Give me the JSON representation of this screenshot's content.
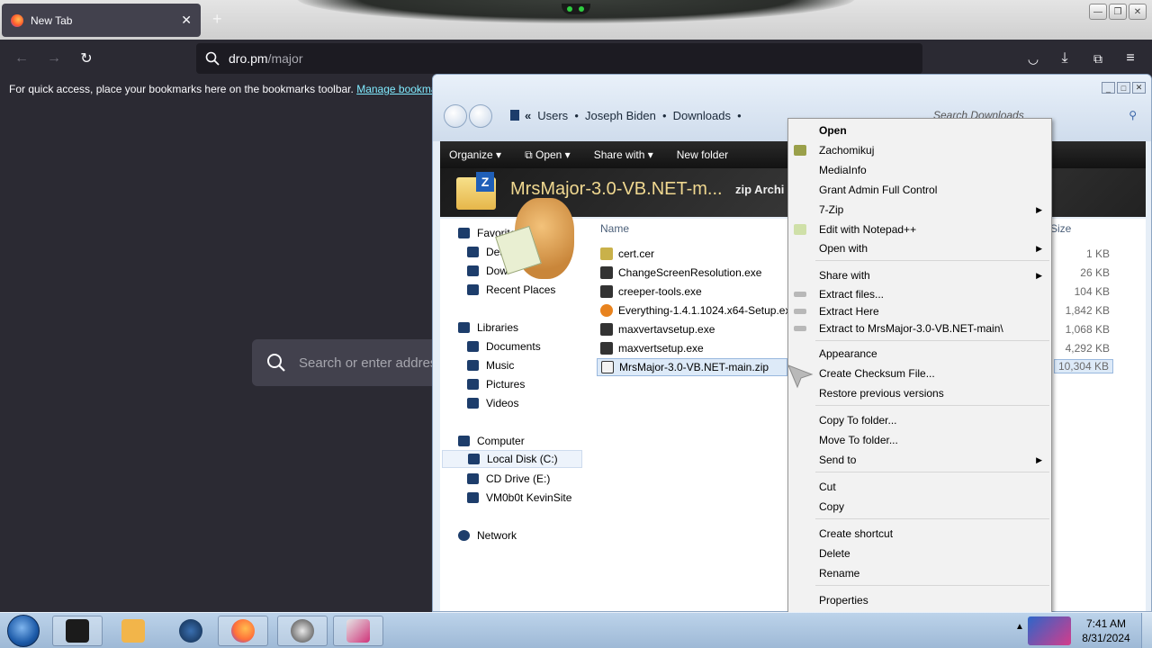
{
  "browser": {
    "tab_title": "New Tab",
    "tab_close": "✕",
    "new_tab": "+",
    "url_host": "dro.pm",
    "url_path": "/major",
    "bookmarks_text": "For quick access, place your bookmarks here on the bookmarks toolbar.",
    "bookmarks_link": "Manage bookmarks",
    "content_search_placeholder": "Search or enter address",
    "icons": [
      "back-icon",
      "forward-icon",
      "reload-icon",
      "search-icon",
      "pocket-icon",
      "download-icon",
      "extensions-icon",
      "menu-icon"
    ]
  },
  "explorer": {
    "breadcrumb": [
      "Users",
      "Joseph Biden",
      "Downloads"
    ],
    "search_placeholder": "Search Downloads",
    "toolbar": [
      "Organize",
      "Open",
      "Share with",
      "New folder"
    ],
    "header_name": "MrsMajor-3.0-VB.NET-m...",
    "header_type": "zip Archi",
    "columns": {
      "name": "Name",
      "size": "Size"
    },
    "nav": {
      "favorites": "Favorites",
      "favorites_items": [
        "Des",
        "Dow",
        "Recent Places"
      ],
      "libraries": "Libraries",
      "library_items": [
        "Documents",
        "Music",
        "Pictures",
        "Videos"
      ],
      "computer": "Computer",
      "computer_items": [
        "Local Disk (C:)",
        "CD Drive (E:)",
        "VM0b0t KevinSite"
      ],
      "network": "Network"
    },
    "files": [
      {
        "name": "cert.cer",
        "size": "1 KB"
      },
      {
        "name": "ChangeScreenResolution.exe",
        "size": "26 KB"
      },
      {
        "name": "creeper-tools.exe",
        "size": "104 KB"
      },
      {
        "name": "Everything-1.4.1.1024.x64-Setup.exe",
        "size": "1,842 KB"
      },
      {
        "name": "maxvertavsetup.exe",
        "size": "1,068 KB"
      },
      {
        "name": "maxvertsetup.exe",
        "size": "4,292 KB"
      },
      {
        "name": "MrsMajor-3.0-VB.NET-main.zip",
        "size": "10,304 KB"
      }
    ]
  },
  "context_menu": [
    "Open",
    "Zachomikuj",
    "MediaInfo",
    "Grant Admin Full Control",
    "7-Zip",
    "Edit with Notepad++",
    "Open with",
    "Share with",
    "Extract files...",
    "Extract Here",
    "Extract to MrsMajor-3.0-VB.NET-main\\",
    "Appearance",
    "Create Checksum File...",
    "Restore previous versions",
    "Copy To folder...",
    "Move To folder...",
    "Send to",
    "Cut",
    "Copy",
    "Create shortcut",
    "Delete",
    "Rename",
    "Properties"
  ],
  "taskbar": {
    "time": "7:41 AM",
    "date": "8/31/2024",
    "colors": {
      "firefox": "#ff7139",
      "start": "#1c5aa8"
    }
  }
}
